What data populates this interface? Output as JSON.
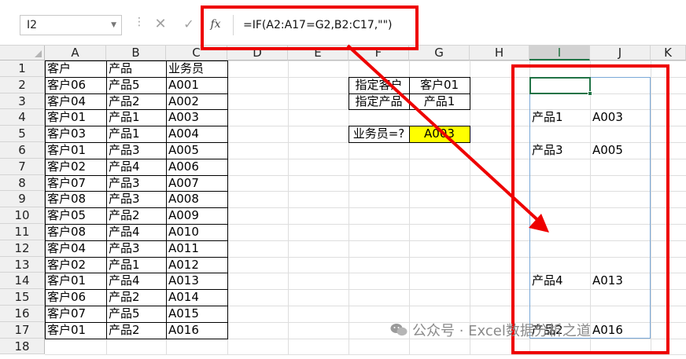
{
  "formula_bar": {
    "name_box": "I2",
    "fx": "fx",
    "cancel": "✕",
    "enter": "✓",
    "formula": "=IF(A2:A17=G2,B2:C17,\"\")"
  },
  "columns": [
    "A",
    "B",
    "C",
    "D",
    "E",
    "F",
    "G",
    "H",
    "I",
    "J",
    "K"
  ],
  "rows": [
    "1",
    "2",
    "3",
    "4",
    "5",
    "6",
    "7",
    "8",
    "9",
    "10",
    "11",
    "12",
    "13",
    "14",
    "15",
    "16",
    "17",
    "18"
  ],
  "table": {
    "headers": [
      "客户",
      "产品",
      "业务员"
    ],
    "rows": [
      [
        "客户06",
        "产品5",
        "A001"
      ],
      [
        "客户04",
        "产品2",
        "A002"
      ],
      [
        "客户01",
        "产品1",
        "A003"
      ],
      [
        "客户03",
        "产品1",
        "A004"
      ],
      [
        "客户01",
        "产品3",
        "A005"
      ],
      [
        "客户02",
        "产品4",
        "A006"
      ],
      [
        "客户07",
        "产品3",
        "A007"
      ],
      [
        "客户08",
        "产品3",
        "A008"
      ],
      [
        "客户05",
        "产品2",
        "A009"
      ],
      [
        "客户08",
        "产品4",
        "A010"
      ],
      [
        "客户04",
        "产品3",
        "A011"
      ],
      [
        "客户02",
        "产品1",
        "A012"
      ],
      [
        "客户01",
        "产品4",
        "A013"
      ],
      [
        "客户06",
        "产品2",
        "A014"
      ],
      [
        "客户07",
        "产品5",
        "A015"
      ],
      [
        "客户01",
        "产品2",
        "A016"
      ]
    ]
  },
  "criteria": {
    "customer_label": "指定客户",
    "customer_value": "客户01",
    "product_label": "指定产品",
    "product_value": "产品1",
    "salesperson_label": "业务员=?",
    "salesperson_value": "A003"
  },
  "spill_results": [
    {
      "row": "4",
      "product": "产品1",
      "salesperson": "A003"
    },
    {
      "row": "6",
      "product": "产品3",
      "salesperson": "A005"
    },
    {
      "row": "14",
      "product": "产品4",
      "salesperson": "A013"
    },
    {
      "row": "17",
      "product": "产品2",
      "salesperson": "A016"
    }
  ],
  "watermark": "公众号 · Excel数据分析之道",
  "colors": {
    "annotation_red": "#ee0000",
    "highlight_yellow": "#ffff00",
    "selection_green": "#217346",
    "spill_border": "#7aa9d8"
  }
}
